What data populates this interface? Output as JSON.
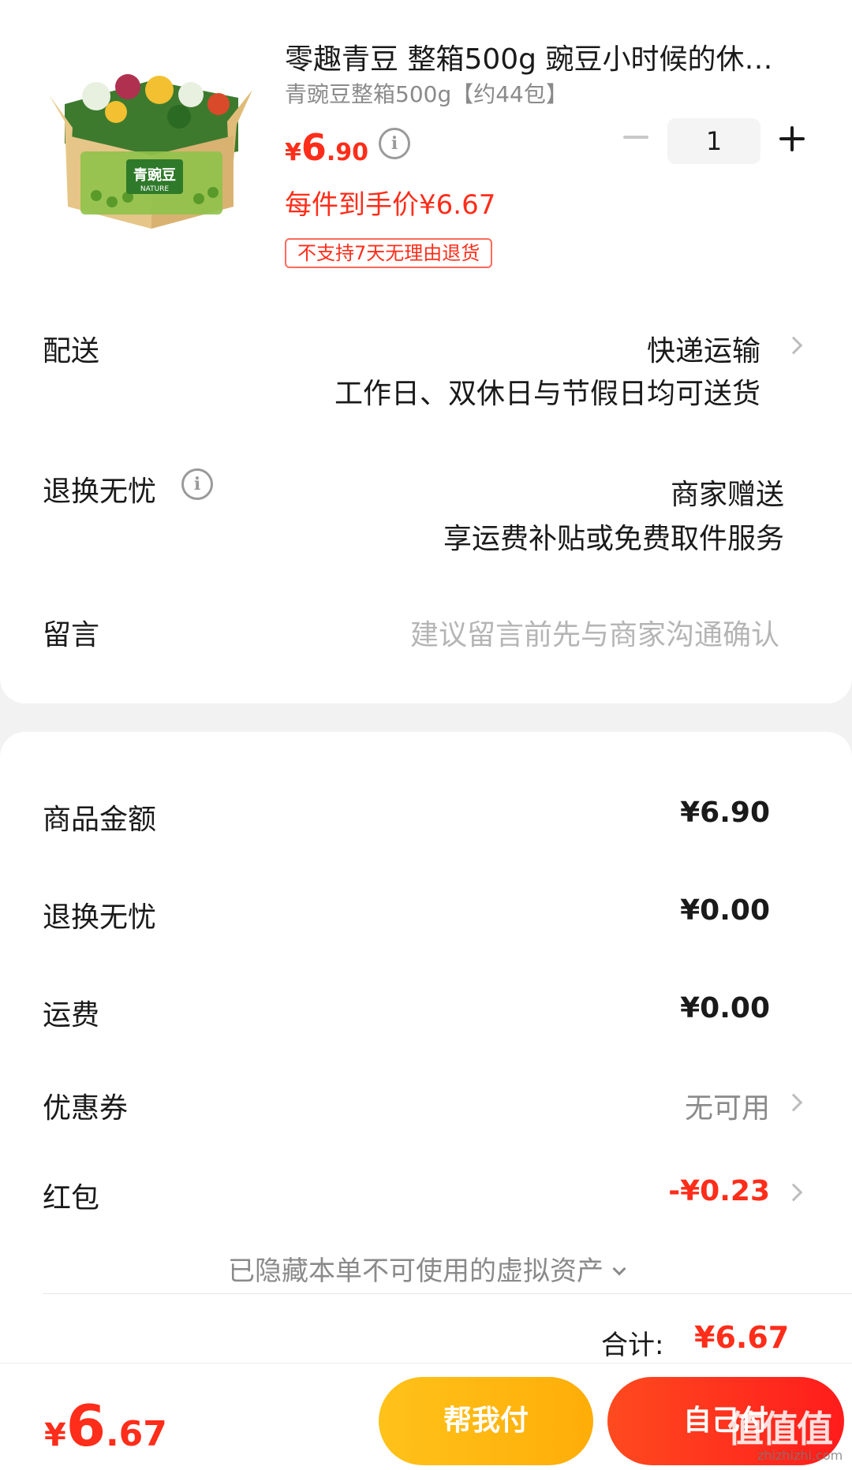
{
  "product": {
    "title": "零趣青豆 整箱500g 豌豆小时候的休…",
    "spec": "青豌豆整箱500g【约44包】",
    "price_currency": "¥",
    "price_int": "6",
    "price_dec": ".90",
    "final_price": "每件到手价¥6.67",
    "tag": "不支持7天无理由退货",
    "quantity": "1",
    "image_text": "青豌豆",
    "image_subtext": "NATURE"
  },
  "delivery": {
    "label": "配送",
    "method": "快递运输",
    "note": "工作日、双休日与节假日均可送货"
  },
  "return_service": {
    "label": "退换无忧",
    "value": "商家赠送",
    "note": "享运费补贴或免费取件服务"
  },
  "message": {
    "label": "留言",
    "placeholder": "建议留言前先与商家沟通确认"
  },
  "summary": {
    "goods_label": "商品金额",
    "goods_value": "¥6.90",
    "return_label": "退换无忧",
    "return_value": "¥0.00",
    "shipping_label": "运费",
    "shipping_value": "¥0.00",
    "coupon_label": "优惠券",
    "coupon_value": "无可用",
    "redpacket_label": "红包",
    "redpacket_value": "-¥0.23",
    "hidden_note": "已隐藏本单不可使用的虚拟资产",
    "total_label": "合计:",
    "total_value": "¥6.67"
  },
  "bottom": {
    "currency": "¥",
    "price_int": "6",
    "price_dec": ".67",
    "help_pay": "帮我付",
    "self_pay": "自己付",
    "watermark": "值值值",
    "watermark_url": "zhizhizhi.com"
  },
  "colors": {
    "accent_red": "#ff2d1a",
    "accent_yellow": "#ffc21a",
    "text_gray": "#8a8a8a"
  }
}
